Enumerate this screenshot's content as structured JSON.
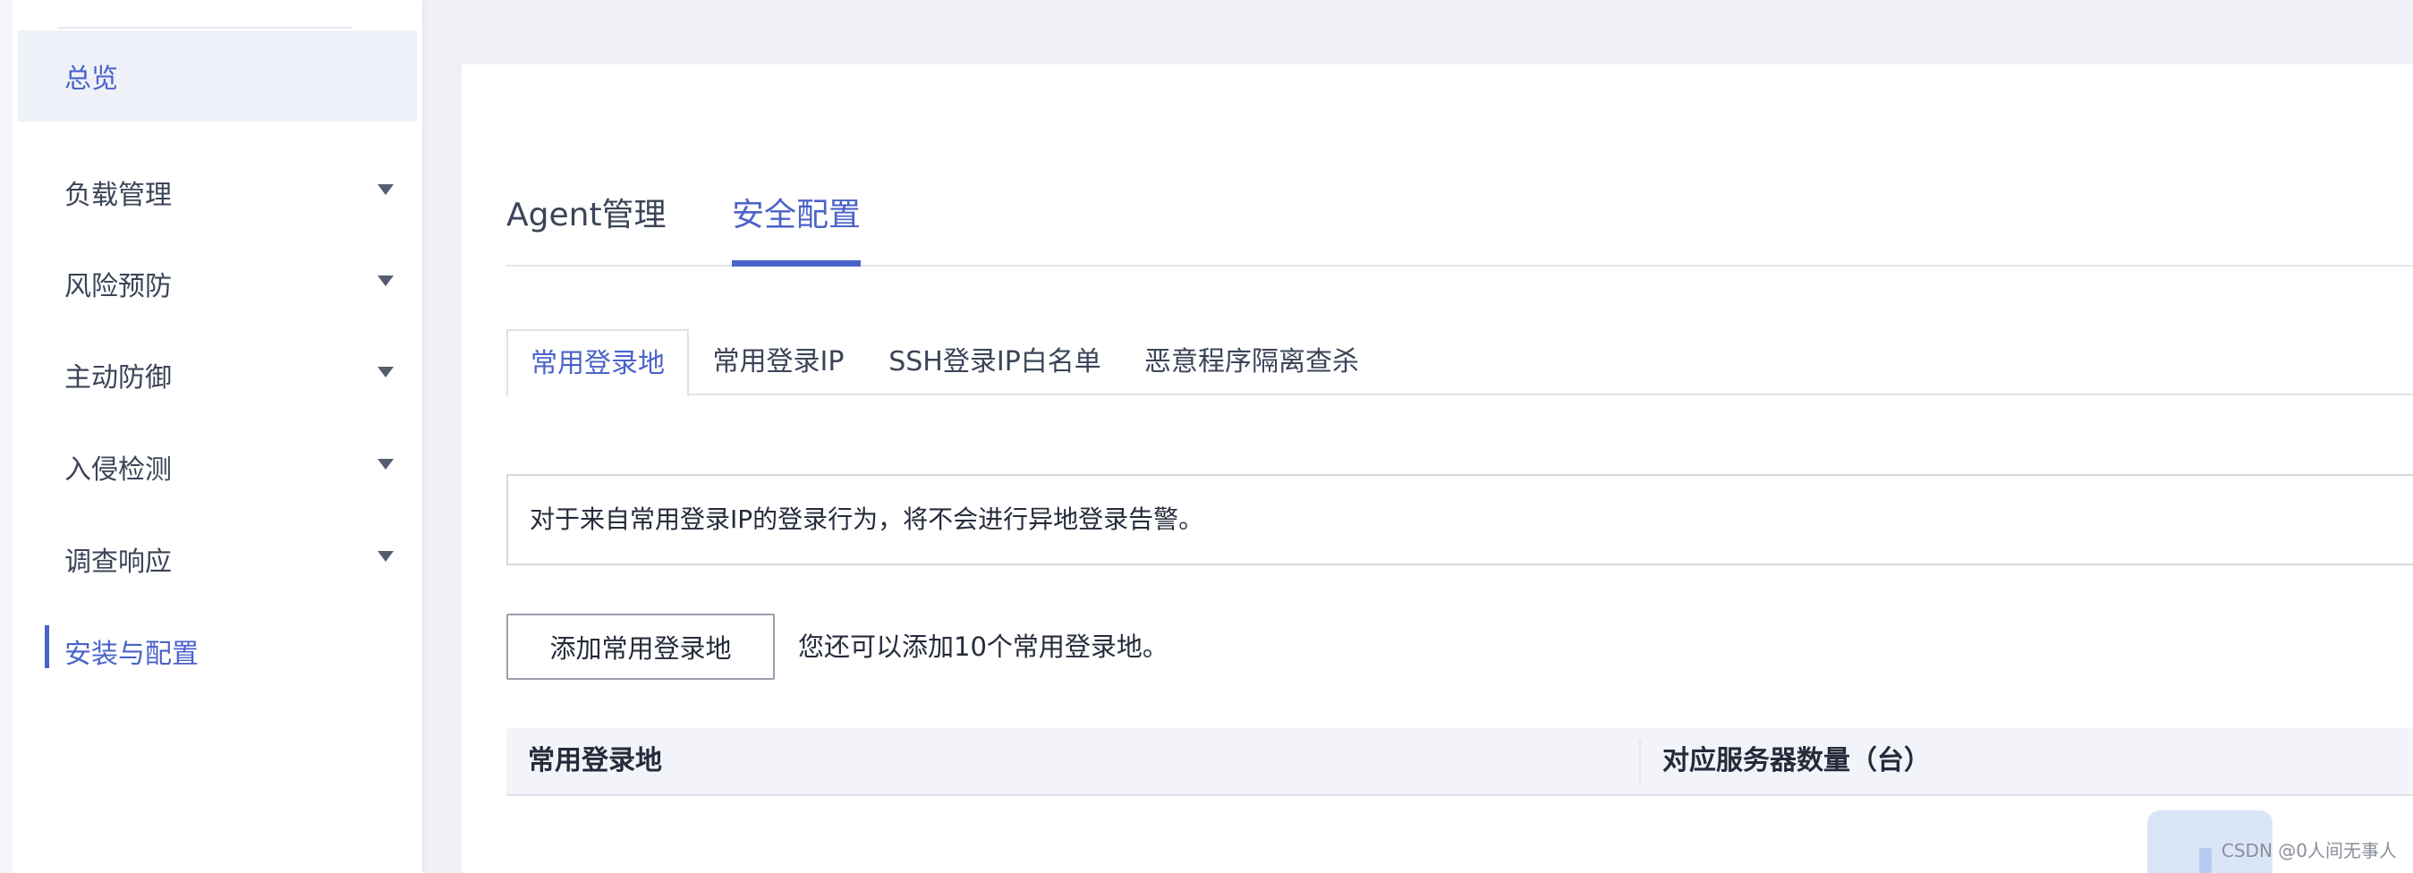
{
  "sidebar": {
    "items": [
      {
        "label": "总览",
        "expandable": false
      },
      {
        "label": "负载管理",
        "expandable": true
      },
      {
        "label": "风险预防",
        "expandable": true
      },
      {
        "label": "主动防御",
        "expandable": true
      },
      {
        "label": "入侵检测",
        "expandable": true
      },
      {
        "label": "调查响应",
        "expandable": true
      },
      {
        "label": "安装与配置",
        "expandable": false,
        "selected": true
      }
    ]
  },
  "main": {
    "tabs": [
      {
        "label": "Agent管理"
      },
      {
        "label": "安全配置",
        "active": true
      }
    ],
    "sub_tabs": [
      {
        "label": "常用登录地",
        "active": true
      },
      {
        "label": "常用登录IP"
      },
      {
        "label": "SSH登录IP白名单"
      },
      {
        "label": "恶意程序隔离查杀"
      }
    ],
    "info_text": "对于来自常用登录IP的登录行为，将不会进行异地登录告警。",
    "add_button_label": "添加常用登录地",
    "add_hint": "您还可以添加10个常用登录地。",
    "table": {
      "columns": [
        "常用登录地",
        "对应服务器数量（台）"
      ]
    }
  },
  "watermark": "CSDN @0人间无事人",
  "colors": {
    "accent": "#4b63c9",
    "page_bg": "#eef0f5",
    "table_head_bg": "#f2f4fa"
  },
  "icons": {
    "expand": "chevron-down-icon"
  }
}
